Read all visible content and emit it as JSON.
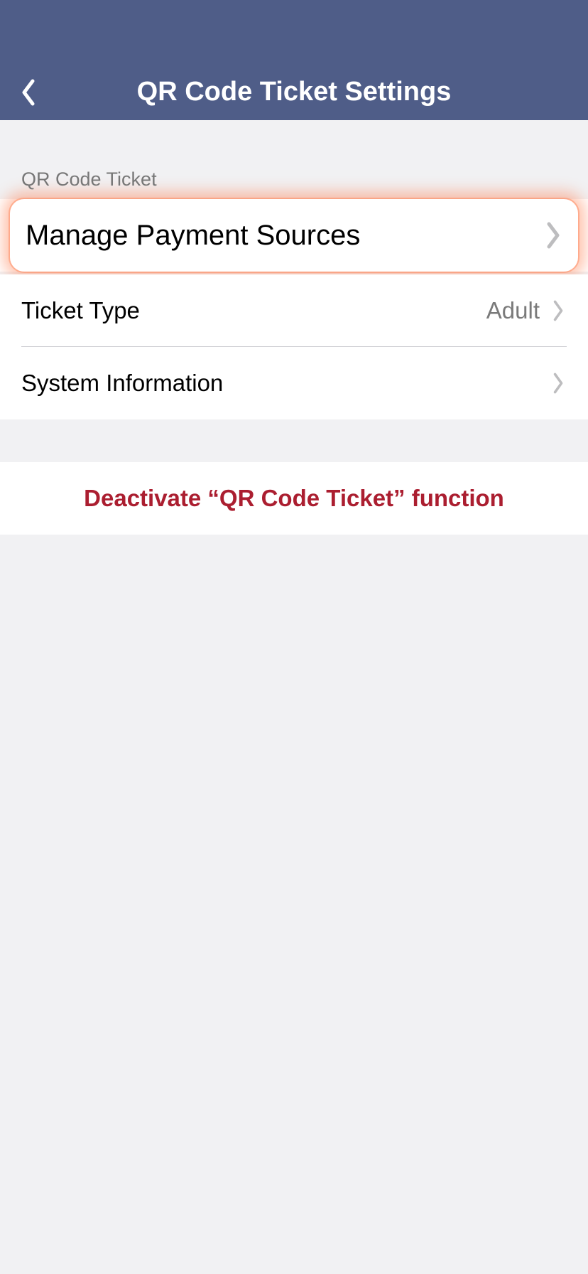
{
  "header": {
    "title": "QR Code Ticket Settings"
  },
  "section": {
    "label": "QR Code Ticket"
  },
  "rows": {
    "manage_payment": {
      "label": "Manage Payment Sources"
    },
    "ticket_type": {
      "label": "Ticket Type",
      "value": "Adult"
    },
    "system_info": {
      "label": "System Information"
    }
  },
  "deactivate": {
    "label": "Deactivate “QR Code Ticket” function"
  }
}
